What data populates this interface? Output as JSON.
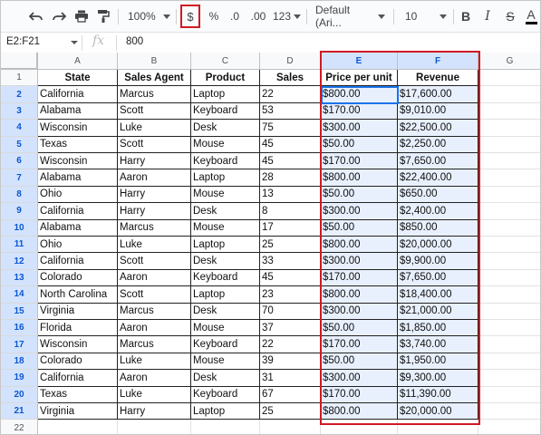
{
  "toolbar": {
    "zoom": "100%",
    "currency_label": "$",
    "percent_label": "%",
    "decrease_decimal_label": ".0",
    "increase_decimal_label": ".00",
    "more_formats_label": "123",
    "font": "Default (Ari...",
    "font_size": "10",
    "bold_label": "B",
    "italic_label": "I",
    "strike_label": "S",
    "text_color_label": "A",
    "accent_color": "#d01a24"
  },
  "formula_bar": {
    "name_box": "E2:F21",
    "fx_label": "fx",
    "value": "800"
  },
  "columns": [
    "A",
    "B",
    "C",
    "D",
    "E",
    "F",
    "G"
  ],
  "row_numbers": [
    "1",
    "2",
    "3",
    "4",
    "5",
    "6",
    "7",
    "8",
    "9",
    "10",
    "11",
    "12",
    "13",
    "14",
    "15",
    "16",
    "17",
    "18",
    "19",
    "20",
    "21",
    "22"
  ],
  "table": {
    "headers": [
      "State",
      "Sales Agent",
      "Product",
      "Sales",
      "Price per unit",
      "Revenue"
    ],
    "rows": [
      [
        "California",
        "Marcus",
        "Laptop",
        "22",
        "$800.00",
        "$17,600.00"
      ],
      [
        "Alabama",
        "Scott",
        "Keyboard",
        "53",
        "$170.00",
        "$9,010.00"
      ],
      [
        "Wisconsin",
        "Luke",
        "Desk",
        "75",
        "$300.00",
        "$22,500.00"
      ],
      [
        "Texas",
        "Scott",
        "Mouse",
        "45",
        "$50.00",
        "$2,250.00"
      ],
      [
        "Wisconsin",
        "Harry",
        "Keyboard",
        "45",
        "$170.00",
        "$7,650.00"
      ],
      [
        "Alabama",
        "Aaron",
        "Laptop",
        "28",
        "$800.00",
        "$22,400.00"
      ],
      [
        "Ohio",
        "Harry",
        "Mouse",
        "13",
        "$50.00",
        "$650.00"
      ],
      [
        "California",
        "Harry",
        "Desk",
        "8",
        "$300.00",
        "$2,400.00"
      ],
      [
        "Alabama",
        "Marcus",
        "Mouse",
        "17",
        "$50.00",
        "$850.00"
      ],
      [
        "Ohio",
        "Luke",
        "Laptop",
        "25",
        "$800.00",
        "$20,000.00"
      ],
      [
        "California",
        "Scott",
        "Desk",
        "33",
        "$300.00",
        "$9,900.00"
      ],
      [
        "Colorado",
        "Aaron",
        "Keyboard",
        "45",
        "$170.00",
        "$7,650.00"
      ],
      [
        "North Carolina",
        "Scott",
        "Laptop",
        "23",
        "$800.00",
        "$18,400.00"
      ],
      [
        "Virginia",
        "Marcus",
        "Desk",
        "70",
        "$300.00",
        "$21,000.00"
      ],
      [
        "Florida",
        "Aaron",
        "Mouse",
        "37",
        "$50.00",
        "$1,850.00"
      ],
      [
        "Wisconsin",
        "Marcus",
        "Keyboard",
        "22",
        "$170.00",
        "$3,740.00"
      ],
      [
        "Colorado",
        "Luke",
        "Mouse",
        "39",
        "$50.00",
        "$1,950.00"
      ],
      [
        "California",
        "Aaron",
        "Desk",
        "31",
        "$300.00",
        "$9,300.00"
      ],
      [
        "Texas",
        "Luke",
        "Keyboard",
        "67",
        "$170.00",
        "$11,390.00"
      ],
      [
        "Virginia",
        "Harry",
        "Laptop",
        "25",
        "$800.00",
        "$20,000.00"
      ]
    ]
  }
}
